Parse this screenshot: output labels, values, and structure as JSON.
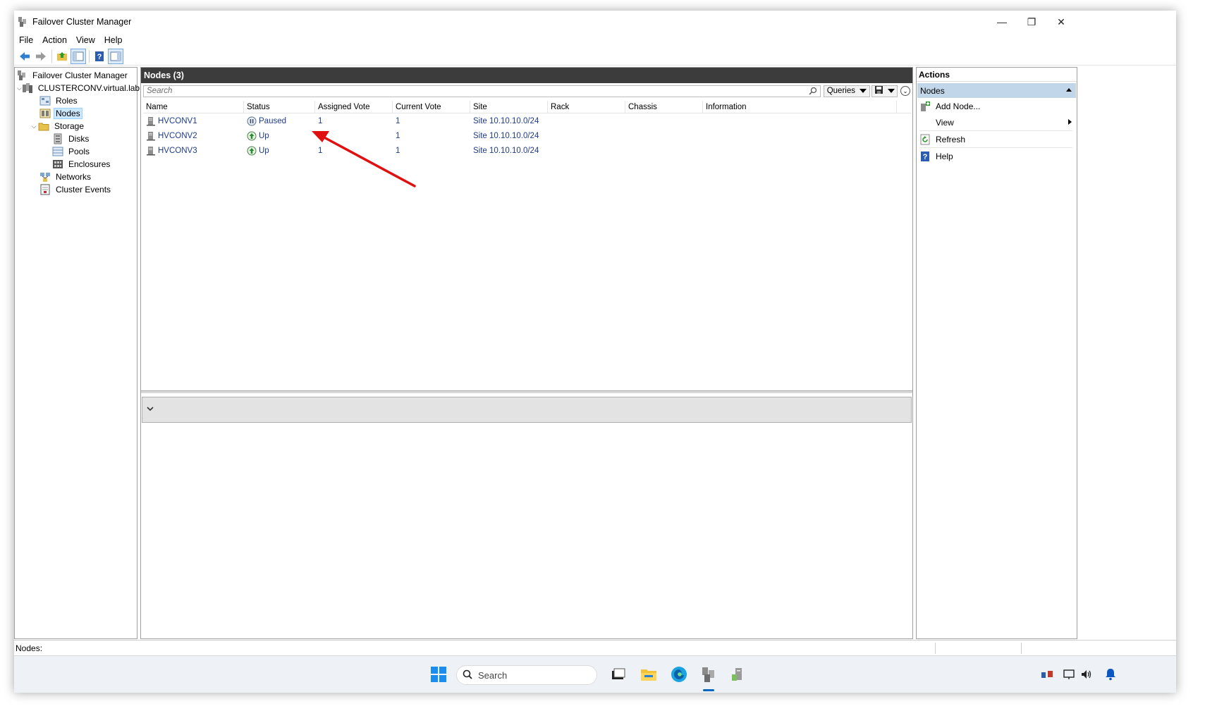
{
  "window": {
    "title": "Failover Cluster Manager",
    "controls": {
      "minimize": "—",
      "restore": "❐",
      "close": "✕"
    }
  },
  "menu": [
    "File",
    "Action",
    "View",
    "Help"
  ],
  "tree": {
    "root": "Failover Cluster Manager",
    "cluster": "CLUSTERCONV.virtual.lab",
    "roles": "Roles",
    "nodes": "Nodes",
    "storage": "Storage",
    "disks": "Disks",
    "pools": "Pools",
    "enclosures": "Enclosures",
    "networks": "Networks",
    "events": "Cluster Events"
  },
  "center": {
    "title": "Nodes (3)",
    "search_placeholder": "Search",
    "queries_label": "Queries",
    "columns": [
      "Name",
      "Status",
      "Assigned Vote",
      "Current Vote",
      "Site",
      "Rack",
      "Chassis",
      "Information"
    ],
    "rows": [
      {
        "name": "HVCONV1",
        "status": "Paused",
        "status_kind": "paused",
        "assigned": "1",
        "current": "1",
        "site": "Site 10.10.10.0/24",
        "rack": "",
        "chassis": "",
        "info": ""
      },
      {
        "name": "HVCONV2",
        "status": "Up",
        "status_kind": "up",
        "assigned": "1",
        "current": "1",
        "site": "Site 10.10.10.0/24",
        "rack": "",
        "chassis": "",
        "info": ""
      },
      {
        "name": "HVCONV3",
        "status": "Up",
        "status_kind": "up",
        "assigned": "1",
        "current": "1",
        "site": "Site 10.10.10.0/24",
        "rack": "",
        "chassis": "",
        "info": ""
      }
    ]
  },
  "actions": {
    "title": "Actions",
    "group": "Nodes",
    "items": [
      "Add Node...",
      "View",
      "Refresh",
      "Help"
    ]
  },
  "statusbar": {
    "text": "Nodes:"
  },
  "taskbar": {
    "search_label": "Search"
  },
  "colors": {
    "accent_arrow": "#e01010",
    "header_dark": "#3c3c3c",
    "link_blue": "#1f3c8a"
  }
}
